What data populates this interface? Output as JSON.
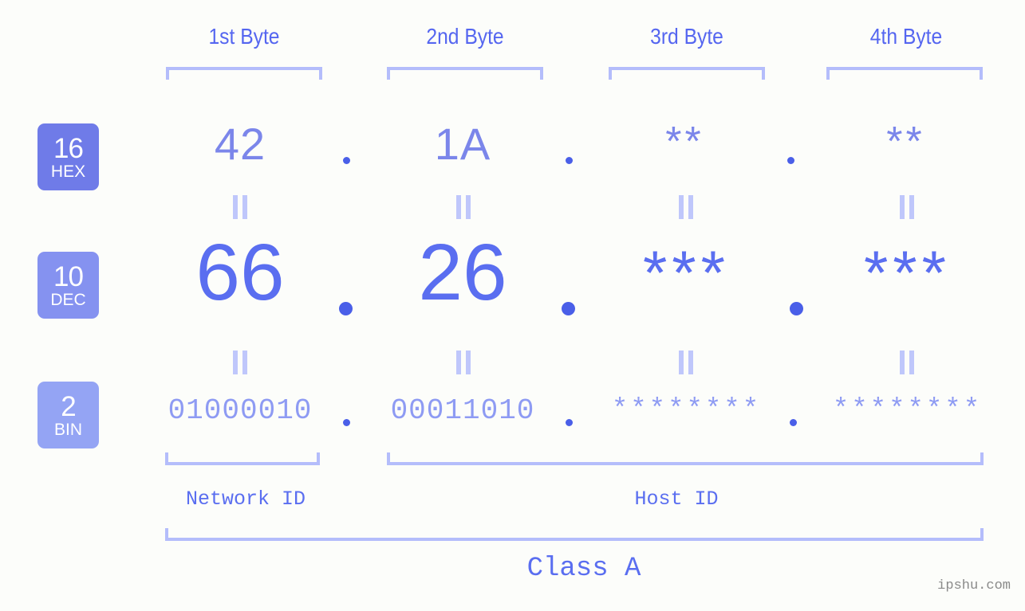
{
  "background_color": "#fcfdfa",
  "accent_color": "#5a6ef0",
  "accent_light_color": "#b4bdfb",
  "byte_headers": [
    {
      "label": "1st Byte"
    },
    {
      "label": "2nd Byte"
    },
    {
      "label": "3rd Byte"
    },
    {
      "label": "4th Byte"
    }
  ],
  "rows": [
    {
      "badge_number": "16",
      "badge_name": "HEX",
      "badge_color": "#6f7be8",
      "values": [
        "42",
        "1A",
        "**",
        "**"
      ],
      "separators": [
        ".",
        ".",
        "."
      ]
    },
    {
      "badge_number": "10",
      "badge_name": "DEC",
      "badge_color": "#8592f0",
      "values": [
        "66",
        "26",
        "***",
        "***"
      ],
      "separators": [
        ".",
        ".",
        "."
      ]
    },
    {
      "badge_number": "2",
      "badge_name": "BIN",
      "badge_color": "#94a4f4",
      "values": [
        "01000010",
        "00011010",
        "********",
        "********"
      ],
      "separators": [
        ".",
        ".",
        "."
      ]
    }
  ],
  "equality_marks": {
    "glyph": "||",
    "count_per_gap": 4,
    "gap_count": 2
  },
  "id_sections": [
    {
      "label": "Network ID"
    },
    {
      "label": "Host ID"
    }
  ],
  "class_label": "Class A",
  "watermark": "ipshu.com"
}
